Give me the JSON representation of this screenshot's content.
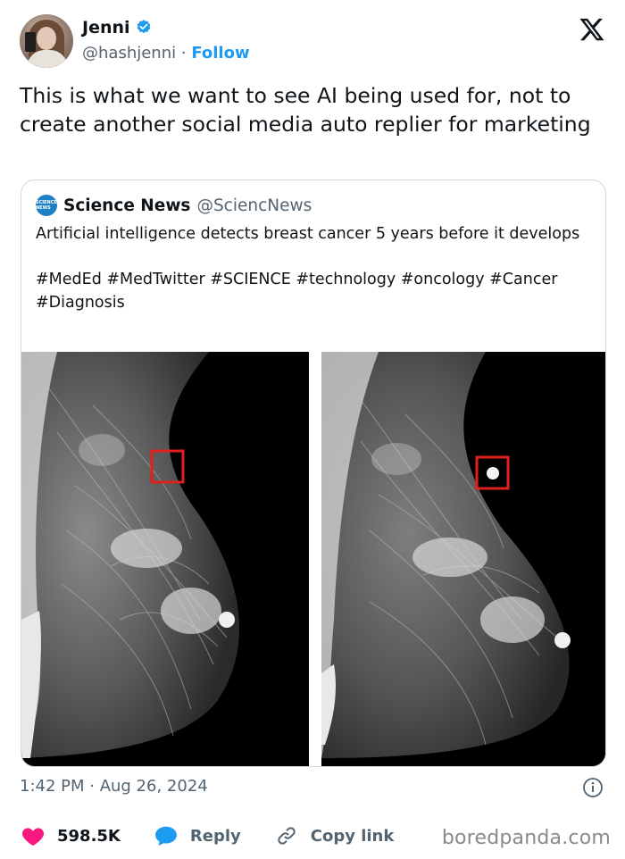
{
  "author": {
    "name": "Jenni",
    "handle": "@hashjenni",
    "separator": "·",
    "follow_label": "Follow",
    "verified": true
  },
  "tweet": {
    "text": "This is what we want to see AI being used for, not to create another social media auto replier for marketing"
  },
  "quote": {
    "logo_text": "SCIENCE NEWS",
    "name": "Science News",
    "handle": "@SciencNews",
    "text": "Artificial intelligence detects breast cancer 5 years before it develops\n\n#MedEd #MedTwitter #SCIENCE #technology #oncology #Cancer #Diagnosis"
  },
  "timestamp": "1:42 PM · Aug 26, 2024",
  "actions": {
    "likes": "598.5K",
    "reply_label": "Reply",
    "copy_label": "Copy link"
  },
  "watermark": "boredpanda.com",
  "colors": {
    "accent": "#1d9bf0",
    "like": "#f91880",
    "text": "#0f1419",
    "muted": "#536471",
    "highlight_box": "#e0201e"
  },
  "icons": [
    "verified-badge-icon",
    "x-logo-icon",
    "info-icon",
    "heart-icon",
    "reply-bubble-icon",
    "link-icon"
  ]
}
